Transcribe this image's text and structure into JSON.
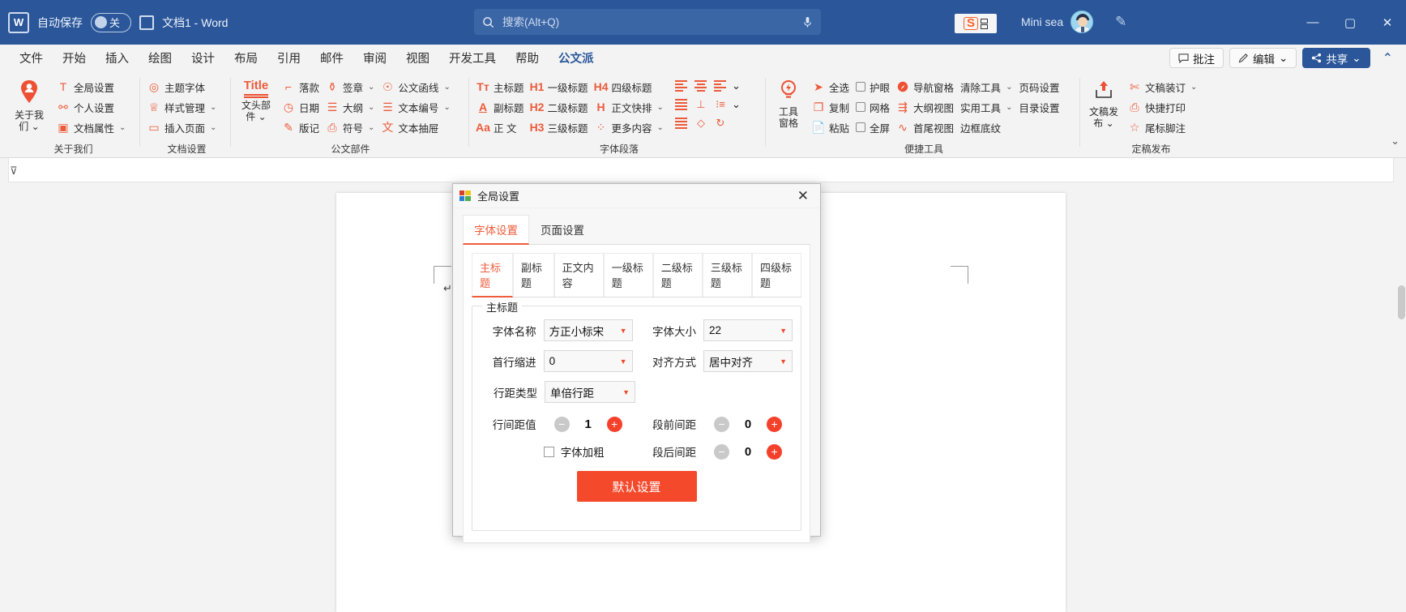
{
  "titlebar": {
    "app_icon": "word-icon",
    "autosave_label": "自动保存",
    "autosave_state": "关",
    "save_icon": "save-icon",
    "doc_title": "文档1  -  Word",
    "search_placeholder": "搜索(Alt+Q)",
    "search_value": "",
    "search_icon": "search-icon",
    "mic_icon": "microphone-icon",
    "sogou_badge": "S",
    "user_name": "Mini sea",
    "pen_icon": "pen-icon",
    "minimize": "—",
    "maximize": "▢",
    "close": "✕"
  },
  "menubar": {
    "items": [
      {
        "label": "文件",
        "active": false
      },
      {
        "label": "开始",
        "active": false
      },
      {
        "label": "插入",
        "active": false
      },
      {
        "label": "绘图",
        "active": false
      },
      {
        "label": "设计",
        "active": false
      },
      {
        "label": "布局",
        "active": false
      },
      {
        "label": "引用",
        "active": false
      },
      {
        "label": "邮件",
        "active": false
      },
      {
        "label": "审阅",
        "active": false
      },
      {
        "label": "视图",
        "active": false
      },
      {
        "label": "开发工具",
        "active": false
      },
      {
        "label": "帮助",
        "active": false
      },
      {
        "label": "公文派",
        "active": true
      }
    ],
    "comment_button": "批注",
    "edit_button": "编辑",
    "share_button": "共享",
    "comment_icon": "comment-icon",
    "edit_icon": "pencil-icon",
    "share_icon": "share-icon",
    "collapse_icon": "collapse-ribbon-icon"
  },
  "ribbon": {
    "groups": [
      {
        "label": "关于我们",
        "has_dialog_launcher": true,
        "big_button": {
          "label": "关于我\n们",
          "icon": "person-icon",
          "has_dropdown": true
        },
        "items": [
          {
            "label": "全局设置",
            "icon": "text-T-icon",
            "dropdown": false
          },
          {
            "label": "个人设置",
            "icon": "person-settings-icon",
            "dropdown": false
          },
          {
            "label": "文档属性",
            "icon": "word-doc-icon",
            "dropdown": true
          }
        ]
      },
      {
        "label": "文档设置",
        "has_dialog_launcher": true,
        "items": [
          {
            "label": "主题字体",
            "icon": "theme-font-icon",
            "dropdown": false
          },
          {
            "label": "样式管理",
            "icon": "style-manage-icon",
            "dropdown": true
          },
          {
            "label": "插入页面",
            "icon": "insert-page-icon",
            "dropdown": true
          }
        ]
      },
      {
        "label": "公文部件",
        "has_dialog_launcher": true,
        "big_button": {
          "label": "文头部\n件",
          "icon": "title-icon",
          "has_dropdown": true
        },
        "columns": [
          [
            {
              "label": "落款",
              "icon": "signature-line-icon",
              "dropdown": false
            },
            {
              "label": "日期",
              "icon": "clock-pin-icon",
              "dropdown": false
            },
            {
              "label": "版记",
              "icon": "edition-note-icon",
              "dropdown": false
            }
          ],
          [
            {
              "label": "签章",
              "icon": "stamp-icon",
              "dropdown": true
            },
            {
              "label": "大纲",
              "icon": "outline-icon",
              "dropdown": true
            },
            {
              "label": "符号",
              "icon": "symbol-icon",
              "dropdown": true
            }
          ],
          [
            {
              "label": "公文函线",
              "icon": "official-line-icon",
              "dropdown": true
            },
            {
              "label": "文本编号",
              "icon": "text-number-icon",
              "dropdown": true
            },
            {
              "label": "文本抽屉",
              "icon": "text-drawer-icon",
              "dropdown": false
            }
          ]
        ]
      },
      {
        "label": "字体段落",
        "has_dialog_launcher": true,
        "columns": [
          [
            {
              "label": "主标题",
              "icon": "Tт",
              "dropdown": false
            },
            {
              "label": "副标题",
              "icon": "A",
              "dropdown": false
            },
            {
              "label": "正 文",
              "icon": "Aa",
              "dropdown": false
            }
          ],
          [
            {
              "label": "一级标题",
              "icon": "H1",
              "dropdown": false
            },
            {
              "label": "二级标题",
              "icon": "H2",
              "dropdown": false
            },
            {
              "label": "三级标题",
              "icon": "H3",
              "dropdown": false
            }
          ],
          [
            {
              "label": "四级标题",
              "icon": "H4",
              "dropdown": false
            },
            {
              "label": "正文快排",
              "icon": "H",
              "dropdown": true
            },
            {
              "label": "更多内容",
              "icon": "more-dots-icon",
              "dropdown": true
            }
          ]
        ],
        "align_icons": [
          [
            "align-left-icon",
            "align-center-icon",
            "indent-right-icon",
            "chevron-down-icon"
          ],
          [
            "align-justify-icon",
            "vertical-align-icon",
            "list-spacing-icon",
            "chevron-down-icon"
          ],
          [
            "align-distribute-icon",
            "clear-format-icon",
            "revert-icon"
          ]
        ]
      },
      {
        "label": "便捷工具",
        "has_dialog_launcher": true,
        "big_button": {
          "label": "工具\n窗格",
          "icon": "lightbulb-icon",
          "has_dropdown": false
        },
        "columns": [
          [
            {
              "label": "全选",
              "icon": "select-all-icon",
              "dropdown": false
            },
            {
              "label": "复制",
              "icon": "copy-icon",
              "dropdown": false
            },
            {
              "label": "粘贴",
              "icon": "paste-icon",
              "dropdown": false
            }
          ],
          [
            {
              "label": "护眼",
              "icon": "checkbox",
              "dropdown": false,
              "checkbox": true
            },
            {
              "label": "网格",
              "icon": "checkbox",
              "dropdown": false,
              "checkbox": true
            },
            {
              "label": "全屏",
              "icon": "checkbox",
              "dropdown": false,
              "checkbox": true
            }
          ],
          [
            {
              "label": "导航窗格",
              "icon": "navigation-pane-icon",
              "dropdown": false
            },
            {
              "label": "大纲视图",
              "icon": "outline-view-icon",
              "dropdown": false
            },
            {
              "label": "首尾视图",
              "icon": "head-tail-view-icon",
              "dropdown": false
            }
          ],
          [
            {
              "label": "清除工具",
              "icon": "",
              "dropdown": true
            },
            {
              "label": "实用工具",
              "icon": "",
              "dropdown": true
            },
            {
              "label": "边框底纹",
              "icon": "",
              "dropdown": false
            }
          ],
          [
            {
              "label": "页码设置",
              "icon": "",
              "dropdown": false
            },
            {
              "label": "目录设置",
              "icon": "",
              "dropdown": false
            }
          ]
        ]
      },
      {
        "label": "定稿发布",
        "has_dialog_launcher": true,
        "big_button": {
          "label": "文稿发\n布",
          "icon": "upload-icon",
          "has_dropdown": true
        },
        "items": [
          {
            "label": "文稿装订",
            "icon": "binding-icon",
            "dropdown": true
          },
          {
            "label": "快捷打印",
            "icon": "print-icon",
            "dropdown": false
          },
          {
            "label": "尾标脚注",
            "icon": "footnote-star-icon",
            "dropdown": false
          }
        ]
      }
    ]
  },
  "document": {
    "paragraph_mark": "↵"
  },
  "dialog": {
    "title": "全局设置",
    "close_label": "✕",
    "tabs_level1": [
      {
        "label": "字体设置",
        "selected": true
      },
      {
        "label": "页面设置",
        "selected": false
      }
    ],
    "tabs_level2": [
      {
        "label": "主标题",
        "selected": true
      },
      {
        "label": "副标题",
        "selected": false
      },
      {
        "label": "正文内容",
        "selected": false
      },
      {
        "label": "一级标题",
        "selected": false
      },
      {
        "label": "二级标题",
        "selected": false
      },
      {
        "label": "三级标题",
        "selected": false
      },
      {
        "label": "四级标题",
        "selected": false
      }
    ],
    "group_legend": "主标题",
    "fields": {
      "font_name_label": "字体名称",
      "font_name_value": "方正小标宋",
      "font_size_label": "字体大小",
      "font_size_value": "22",
      "first_indent_label": "首行缩进",
      "first_indent_value": "0",
      "align_label": "对齐方式",
      "align_value": "居中对齐",
      "line_spacing_type_label": "行距类型",
      "line_spacing_type_value": "单倍行距",
      "line_spacing_value_label": "行间距值",
      "line_spacing_value": "1",
      "space_before_label": "段前间距",
      "space_before_value": "0",
      "space_after_label": "段后间距",
      "space_after_value": "0",
      "bold_label": "字体加粗",
      "bold_checked": false
    },
    "default_button": "默认设置",
    "minus_icon": "minus-circle-icon",
    "plus_icon": "plus-circle-icon"
  },
  "colors": {
    "title_bar": "#2b579a",
    "accent_orange": "#ee5c3b",
    "plus_red": "#f5412b",
    "button_red": "#f5492c",
    "ribbon_bg": "#f3f3f3"
  }
}
